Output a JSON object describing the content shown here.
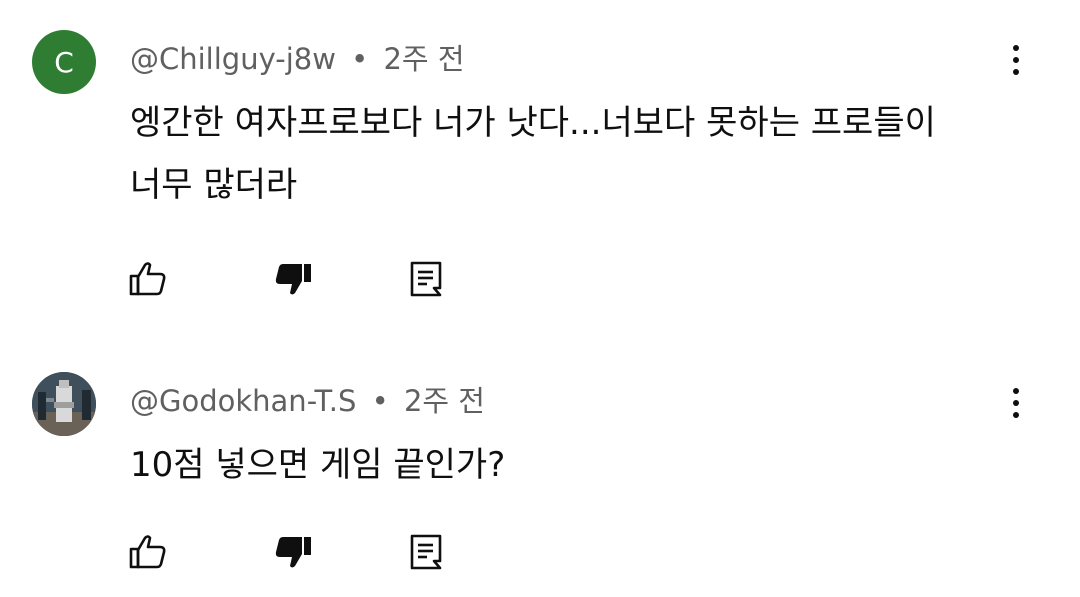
{
  "comments": [
    {
      "avatar_letter": "C",
      "avatar_color": "#2e7d32",
      "handle": "@Chillguy-j8w",
      "separator": "•",
      "time": "2주 전",
      "text_line1": "엥간한 여자프로보다 너가 낫다...너보다 못하는 프로들이",
      "text_line2": "너무 많더라",
      "icons": [
        "like-icon",
        "dislike-icon-filled",
        "reply-icon",
        "more-vert-icon"
      ]
    },
    {
      "avatar_image": "photo",
      "handle": "@Godokhan-T.S",
      "separator": "•",
      "time": "2주 전",
      "text_line1": "10점 넣으면 게임 끝인가?",
      "icons": [
        "like-icon",
        "dislike-icon-filled",
        "reply-icon",
        "more-vert-icon"
      ]
    }
  ]
}
